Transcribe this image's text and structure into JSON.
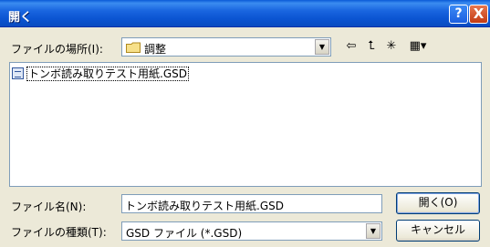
{
  "window": {
    "title": "開く",
    "help_glyph": "?",
    "close_glyph": "X"
  },
  "location": {
    "label": "ファイルの場所(I):",
    "value": "調整",
    "dropdown_glyph": "▼"
  },
  "toolbar": {
    "back_glyph": "⇦",
    "up_glyph": "⮤",
    "new_folder_glyph": "✳",
    "views_glyph": "▦▾"
  },
  "files": [
    {
      "name": "トンボ読み取りテスト用紙.GSD",
      "icon": "gsd-file-icon"
    }
  ],
  "filename": {
    "label": "ファイル名(N):",
    "value": "トンボ読み取りテスト用紙.GSD"
  },
  "filetype": {
    "label": "ファイルの種類(T):",
    "value": "GSD ファイル (*.GSD)",
    "dropdown_glyph": "▼"
  },
  "buttons": {
    "open": "開く(O)",
    "cancel": "キャンセル"
  },
  "colors": {
    "titlebar": "#0a5ad8",
    "face": "#ece9d8",
    "border": "#7f9db9"
  }
}
